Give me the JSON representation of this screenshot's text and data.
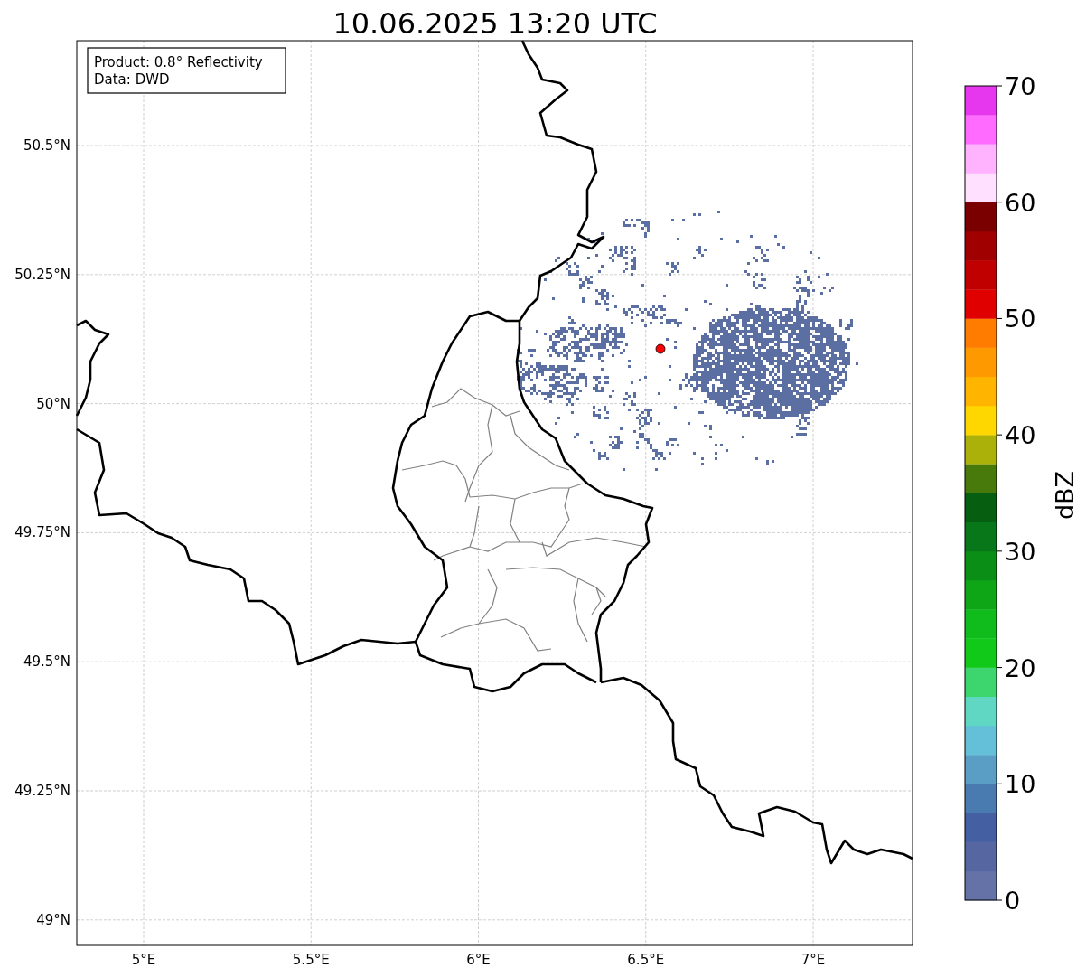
{
  "title": "10.06.2025 13:20 UTC",
  "map": {
    "info_box": [
      "Product: 0.8° Reflectivity",
      "Data: DWD"
    ],
    "x_ticks": [
      "5°E",
      "5.5°E",
      "6°E",
      "6.5°E",
      "7°E"
    ],
    "y_ticks": [
      "50.5°N",
      "50.25°N",
      "50°N",
      "49.75°N",
      "49.5°N",
      "49.25°N",
      "49°N"
    ]
  },
  "colorbar": {
    "label": "dBZ",
    "ticks": [
      "70",
      "60",
      "50",
      "40",
      "30",
      "20",
      "10",
      "0"
    ],
    "bins": [
      {
        "color": "#6472a8"
      },
      {
        "color": "#5566a0"
      },
      {
        "color": "#4460a3"
      },
      {
        "color": "#4a7bb0"
      },
      {
        "color": "#5a9ec5"
      },
      {
        "color": "#63c0d8"
      },
      {
        "color": "#5fd7c3"
      },
      {
        "color": "#3dd56e"
      },
      {
        "color": "#11c918"
      },
      {
        "color": "#10bb1c"
      },
      {
        "color": "#0ea616"
      },
      {
        "color": "#0b8e15"
      },
      {
        "color": "#08771a"
      },
      {
        "color": "#065f10"
      },
      {
        "color": "#477a0b"
      },
      {
        "color": "#acb10a"
      },
      {
        "color": "#ffd700"
      },
      {
        "color": "#ffb400"
      },
      {
        "color": "#ff9900"
      },
      {
        "color": "#ff7c00"
      },
      {
        "color": "#e00000"
      },
      {
        "color": "#c00000"
      },
      {
        "color": "#a00000"
      },
      {
        "color": "#7a0000"
      },
      {
        "color": "#ffe0ff"
      },
      {
        "color": "#ffb3ff"
      },
      {
        "color": "#ff6bff"
      },
      {
        "color": "#e637ef"
      }
    ]
  }
}
